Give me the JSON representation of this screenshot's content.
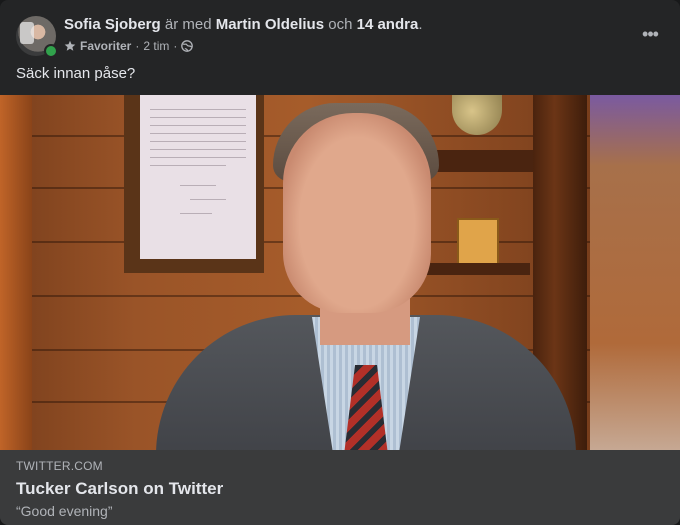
{
  "post": {
    "author": "Sofia Sjoberg",
    "with_text": "är med",
    "tagged_person": "Martin Oldelius",
    "and_text": "och",
    "others": "14 andra",
    "trailing": ".",
    "audience": "Favoriter",
    "separator": "·",
    "time": "2 tim",
    "separator2": "·",
    "body": "Säck innan påse?",
    "more_label": "•••"
  },
  "link_preview": {
    "domain": "TWITTER.COM",
    "title": "Tucker Carlson on Twitter",
    "description": "“Good evening”"
  },
  "icons": {
    "audience": "star-icon",
    "privacy": "globe-icon",
    "more": "more-options-icon",
    "presence": "online-dot"
  },
  "colors": {
    "background": "#242526",
    "text_primary": "#e4e6eb",
    "text_secondary": "#b0b3b8",
    "link_box": "#3a3b3c",
    "online": "#31a24c"
  }
}
